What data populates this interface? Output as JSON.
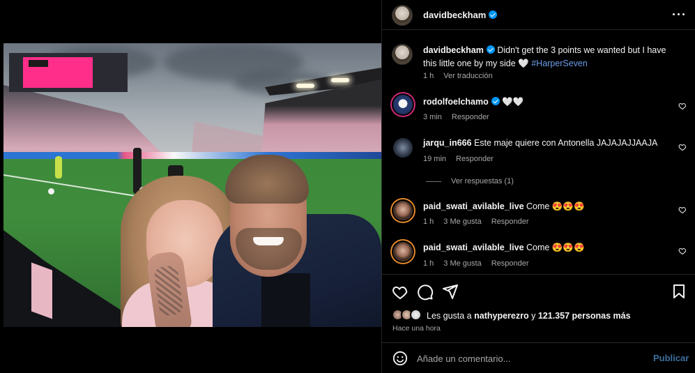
{
  "post": {
    "author": "davidbeckham",
    "caption_text": "Didn't get the 3 points we wanted but I have this little one by my side 🤍",
    "caption_hashtag": "#HarperSeven",
    "caption_time": "1 h",
    "caption_translate": "Ver traducción"
  },
  "comments": [
    {
      "username": "rodolfoelchamo",
      "verified": true,
      "text": "🤍🤍",
      "time": "3 min",
      "likes": "",
      "reply": "Responder"
    },
    {
      "username": "jarqu_in666",
      "verified": false,
      "text": "Este maje quiere con Antonella JAJAJAJJAAJA",
      "time": "19 min",
      "likes": "",
      "reply": "Responder"
    },
    {
      "username": "paid_swati_avilable_live",
      "verified": false,
      "text": "Come 😍😍😍",
      "time": "1 h",
      "likes": "3 Me gusta",
      "reply": "Responder"
    },
    {
      "username": "paid_swati_avilable_live",
      "verified": false,
      "text": "Come 😍😍😍",
      "time": "1 h",
      "likes": "3 Me gusta",
      "reply": "Responder"
    }
  ],
  "view_replies": "Ver respuestas (1)",
  "likes": {
    "prefix": "Les gusta a",
    "liker": "nathyperezro",
    "connector": "y",
    "count": "121.357 personas más"
  },
  "time_ago": "Hace una hora",
  "add_comment": {
    "placeholder": "Añade un comentario...",
    "publish_label": "Publicar"
  },
  "colors": {
    "background": "#000000",
    "text": "#f5f5f5",
    "muted": "#a8a8a8",
    "link": "#6a9eea",
    "verified": "#0095f6",
    "publish": "#3c6f9c"
  },
  "icons": [
    "more-options-icon",
    "verified-badge-icon",
    "heart-icon",
    "comment-icon",
    "share-icon",
    "bookmark-icon",
    "emoji-icon"
  ]
}
